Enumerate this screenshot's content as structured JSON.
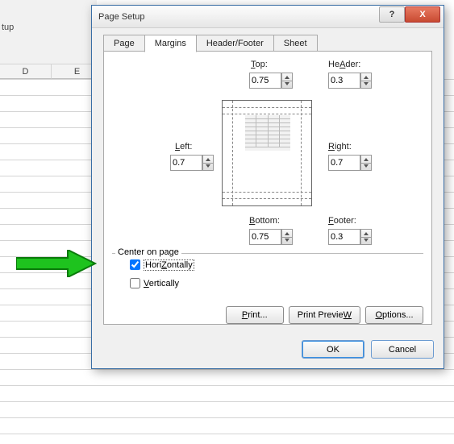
{
  "ribbon": {
    "fragment": "tup"
  },
  "columns": [
    "D",
    "E"
  ],
  "dialog": {
    "title": "Page Setup",
    "help": "?",
    "close": "X",
    "tabs": [
      "Page",
      "Margins",
      "Header/Footer",
      "Sheet"
    ],
    "active_tab": 1,
    "margins": {
      "top": {
        "label": "Top:",
        "accel": "T",
        "value": "0.75"
      },
      "header": {
        "label": "Header:",
        "accel": "A",
        "value": "0.3"
      },
      "left": {
        "label": "Left:",
        "accel": "L",
        "value": "0.7"
      },
      "right": {
        "label": "Right:",
        "accel": "R",
        "value": "0.7"
      },
      "bottom": {
        "label": "Bottom:",
        "accel": "B",
        "value": "0.75"
      },
      "footer": {
        "label": "Footer:",
        "accel": "F",
        "value": "0.3"
      }
    },
    "center": {
      "group": "Center on page",
      "horiz": {
        "label": "Horizontally",
        "accel": "Z",
        "checked": true
      },
      "vert": {
        "label": "Vertically",
        "accel": "V",
        "checked": false
      }
    },
    "buttons": {
      "print": "Print...",
      "print_accel": "P",
      "preview": "Print Preview",
      "preview_accel": "W",
      "options": "Options...",
      "options_accel": "O",
      "ok": "OK",
      "cancel": "Cancel"
    }
  }
}
